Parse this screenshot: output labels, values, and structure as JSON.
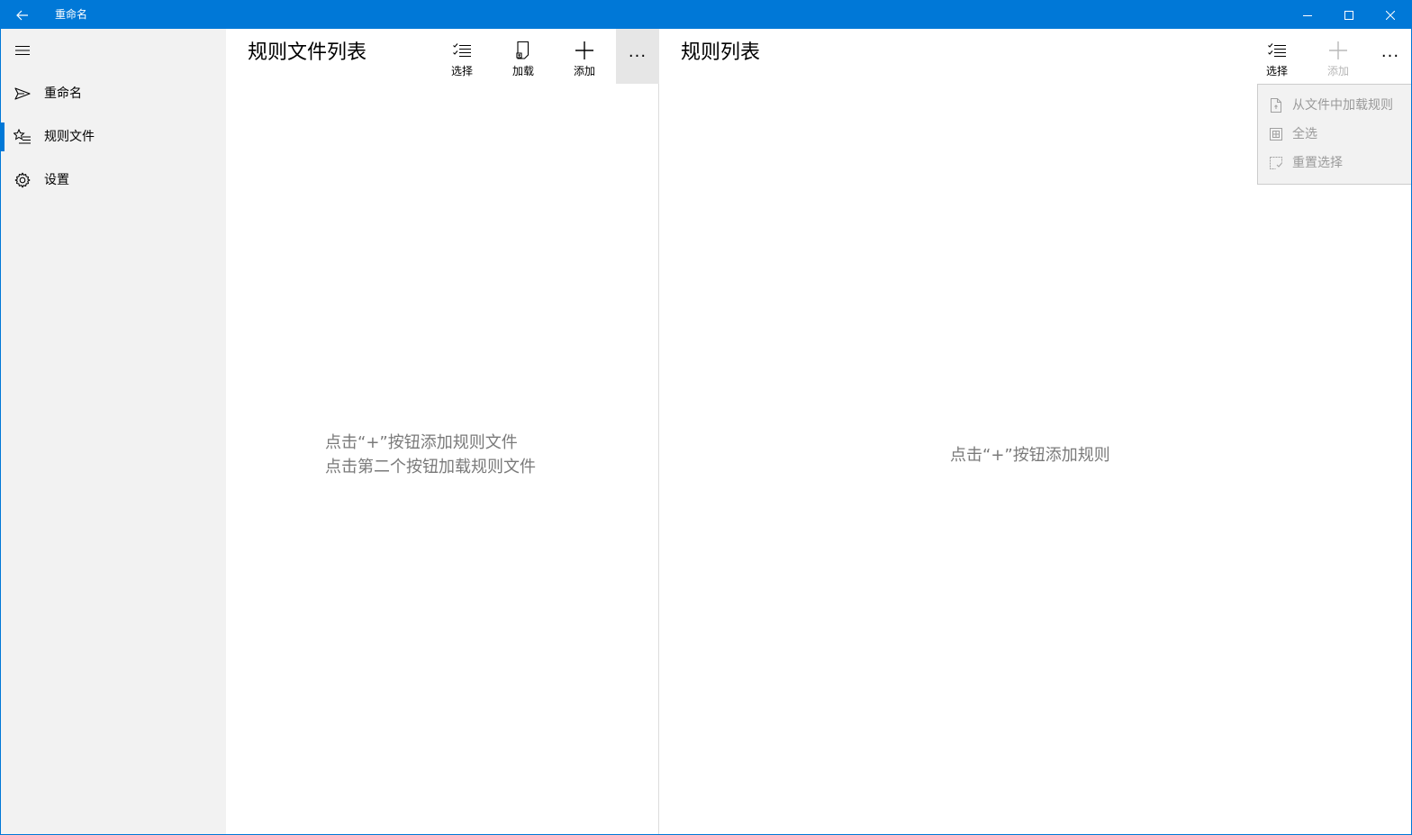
{
  "titlebar": {
    "title": "重命名",
    "accent": "#0078d7",
    "back_icon": "back-arrow-icon",
    "min_icon": "minimize-icon",
    "max_icon": "maximize-icon",
    "close_icon": "close-icon"
  },
  "nav": {
    "menu_icon": "hamburger-icon",
    "items": [
      {
        "label": "重命名",
        "icon": "send-icon",
        "selected": false
      },
      {
        "label": "规则文件",
        "icon": "favorite-list-icon",
        "selected": true
      },
      {
        "label": "设置",
        "icon": "gear-icon",
        "selected": false
      }
    ]
  },
  "left_panel": {
    "title": "规则文件列表",
    "commands": [
      {
        "label": "选择",
        "icon": "multiselect-icon",
        "enabled": true
      },
      {
        "label": "加载",
        "icon": "open-file-icon",
        "enabled": true
      },
      {
        "label": "添加",
        "icon": "add-icon",
        "enabled": true
      }
    ],
    "more": "···",
    "empty_line1": "点击“+”按钮添加规则文件",
    "empty_line2": "点击第二个按钮加载规则文件"
  },
  "right_panel": {
    "title": "规则列表",
    "commands": [
      {
        "label": "选择",
        "icon": "multiselect-icon",
        "enabled": true
      },
      {
        "label": "添加",
        "icon": "add-icon",
        "enabled": false
      }
    ],
    "more": "···",
    "empty_text": "点击“+”按钮添加规则",
    "menu": [
      {
        "label": "从文件中加载规则",
        "icon": "file-import-icon",
        "enabled": false
      },
      {
        "label": "全选",
        "icon": "select-all-icon",
        "enabled": false
      },
      {
        "label": "重置选择",
        "icon": "clear-selection-icon",
        "enabled": false
      }
    ]
  }
}
